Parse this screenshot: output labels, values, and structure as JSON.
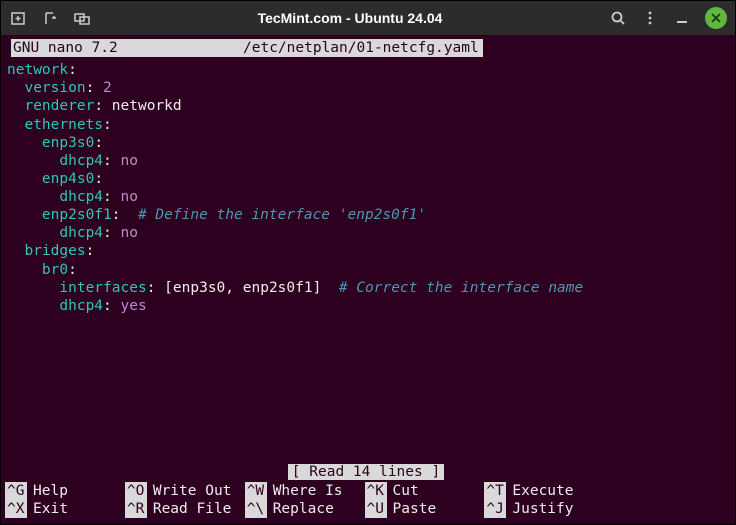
{
  "titlebar": {
    "title": "TecMint.com - Ubuntu 24.04"
  },
  "nano": {
    "app_label": "GNU nano 7.2",
    "filename": "/etc/netplan/01-netcfg.yaml",
    "status": "[ Read 14 lines ]"
  },
  "file_lines": [
    {
      "indent": 0,
      "key": "network",
      "val": "",
      "comment": ""
    },
    {
      "indent": 1,
      "key": "version",
      "val_num": "2",
      "comment": ""
    },
    {
      "indent": 1,
      "key": "renderer",
      "val": "networkd",
      "comment": ""
    },
    {
      "indent": 1,
      "key": "ethernets",
      "val": "",
      "comment": ""
    },
    {
      "indent": 2,
      "key": "enp3s0",
      "val": "",
      "comment": ""
    },
    {
      "indent": 3,
      "key": "dhcp4",
      "val_num": "no",
      "comment": ""
    },
    {
      "indent": 2,
      "key": "enp4s0",
      "val": "",
      "comment": ""
    },
    {
      "indent": 3,
      "key": "dhcp4",
      "val_num": "no",
      "comment": ""
    },
    {
      "indent": 2,
      "key": "enp2s0f1",
      "val": "",
      "comment": "# Define the interface 'enp2s0f1'",
      "pad": "  "
    },
    {
      "indent": 3,
      "key": "dhcp4",
      "val_num": "no",
      "comment": ""
    },
    {
      "indent": 1,
      "key": "bridges",
      "val": "",
      "comment": ""
    },
    {
      "indent": 2,
      "key": "br0",
      "val": "",
      "comment": ""
    },
    {
      "indent": 3,
      "key": "interfaces",
      "list": [
        "enp3s0",
        "enp2s0f1"
      ],
      "comment": "# Correct the interface name",
      "pad": "  "
    },
    {
      "indent": 3,
      "key": "dhcp4",
      "val_num": "yes",
      "comment": ""
    }
  ],
  "shortcuts_row1": [
    {
      "key": "^G",
      "label": "Help"
    },
    {
      "key": "^O",
      "label": "Write Out"
    },
    {
      "key": "^W",
      "label": "Where Is"
    },
    {
      "key": "^K",
      "label": "Cut"
    },
    {
      "key": "^T",
      "label": "Execute"
    }
  ],
  "shortcuts_row2": [
    {
      "key": "^X",
      "label": "Exit"
    },
    {
      "key": "^R",
      "label": "Read File"
    },
    {
      "key": "^\\",
      "label": "Replace"
    },
    {
      "key": "^U",
      "label": "Paste"
    },
    {
      "key": "^J",
      "label": "Justify"
    }
  ]
}
